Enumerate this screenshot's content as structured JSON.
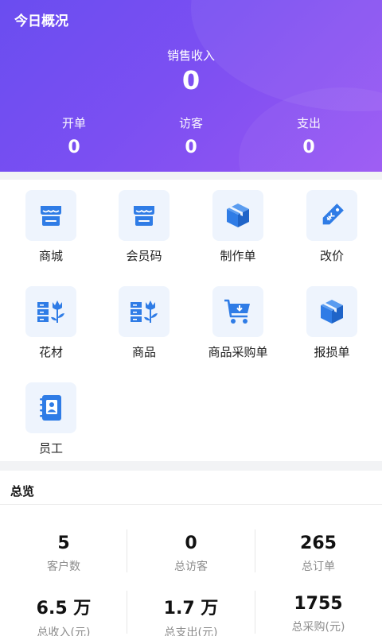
{
  "header": {
    "title": "今日概况",
    "sales_label": "销售收入",
    "sales_value": "0",
    "stats": [
      {
        "label": "开单",
        "value": "0"
      },
      {
        "label": "访客",
        "value": "0"
      },
      {
        "label": "支出",
        "value": "0"
      }
    ]
  },
  "menu": {
    "items": [
      {
        "label": "商城",
        "icon": "store-icon"
      },
      {
        "label": "会员码",
        "icon": "store-icon"
      },
      {
        "label": "制作单",
        "icon": "box-icon"
      },
      {
        "label": "改价",
        "icon": "price-tag-icon"
      },
      {
        "label": "花材",
        "icon": "flower-rack-icon"
      },
      {
        "label": "商品",
        "icon": "flower-rack-icon"
      },
      {
        "label": "商品采购单",
        "icon": "shopping-cart-icon"
      },
      {
        "label": "报损单",
        "icon": "box-icon"
      },
      {
        "label": "员工",
        "icon": "staff-book-icon"
      }
    ],
    "icon_color": "#2f7ce6",
    "icon_bg": "#eef4fd"
  },
  "overview": {
    "title": "总览",
    "cells": [
      {
        "value": "5",
        "caption": "客户数"
      },
      {
        "value": "0",
        "caption": "总访客"
      },
      {
        "value": "265",
        "caption": "总订单"
      },
      {
        "value": "6.5 万",
        "caption": "总收入(元)"
      },
      {
        "value": "1.7 万",
        "caption": "总支出(元)"
      },
      {
        "value": "1755",
        "caption": "总采购(元)"
      }
    ]
  }
}
